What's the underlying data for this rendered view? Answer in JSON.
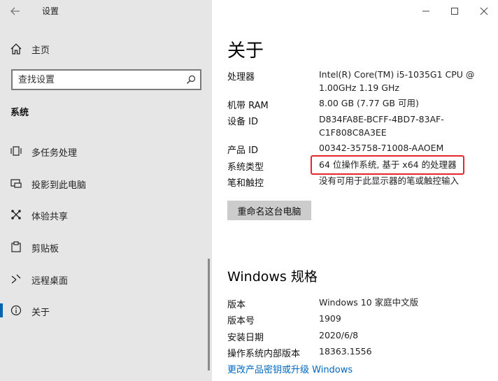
{
  "window": {
    "title": "设置",
    "controls": {
      "minimize": "minimize-icon",
      "maximize": "maximize-icon",
      "close": "close-icon"
    }
  },
  "sidebar": {
    "home_label": "主页",
    "search_placeholder": "查找设置",
    "section_label": "系统",
    "items": [
      {
        "label": "多任务处理",
        "icon": "multitask-icon"
      },
      {
        "label": "投影到此电脑",
        "icon": "project-icon"
      },
      {
        "label": "体验共享",
        "icon": "share-icon"
      },
      {
        "label": "剪贴板",
        "icon": "clipboard-icon"
      },
      {
        "label": "远程桌面",
        "icon": "remote-desktop-icon"
      },
      {
        "label": "关于",
        "icon": "info-icon",
        "active": true
      }
    ]
  },
  "content": {
    "title": "关于",
    "device_specs": [
      {
        "label": "处理器",
        "value_lines": [
          "Intel(R) Core(TM) i5-1035G1 CPU @",
          "1.00GHz   1.19 GHz"
        ]
      },
      {
        "label": "机带 RAM",
        "value_lines": [
          "8.00 GB (7.77 GB 可用)"
        ]
      },
      {
        "label": "设备 ID",
        "value_lines": [
          "D834FA8E-BCFF-4BD7-83AF-",
          "C1F808C8A3EE"
        ]
      },
      {
        "label": "产品 ID",
        "value_lines": [
          "00342-35758-71008-AAOEM"
        ]
      },
      {
        "label": "系统类型",
        "value_lines": [
          "64 位操作系统, 基于 x64 的处理器"
        ]
      },
      {
        "label": "笔和触控",
        "value_lines": [
          "没有可用于此显示器的笔或触控输入"
        ]
      }
    ],
    "rename_button": "重命名这台电脑",
    "windows_section_title": "Windows 规格",
    "windows_specs": [
      {
        "label": "版本",
        "value": "Windows 10 家庭中文版"
      },
      {
        "label": "版本号",
        "value": "1909"
      },
      {
        "label": "安装日期",
        "value": "2020/6/8"
      },
      {
        "label": "操作系统内部版本",
        "value": "18363.1556"
      }
    ],
    "link": "更改产品密钥或升级 Windows"
  },
  "colors": {
    "accent": "#0063b1",
    "highlight": "#e8262a",
    "link": "#0067c0",
    "sidebar_bg": "#e6e6e6"
  }
}
